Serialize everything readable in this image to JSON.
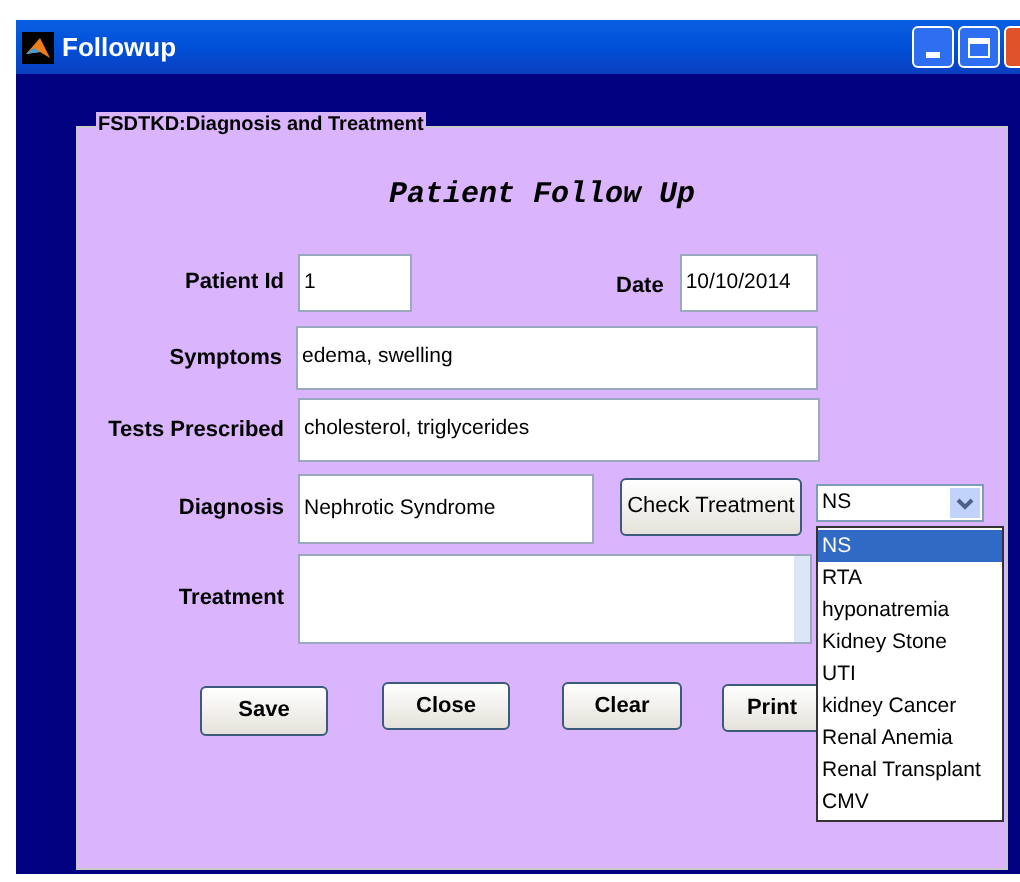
{
  "window": {
    "title": "Followup"
  },
  "panel": {
    "title": "FSDTKD:Diagnosis and Treatment"
  },
  "heading": "Patient Follow Up",
  "patient_id": {
    "label": "Patient Id",
    "value": "1"
  },
  "date": {
    "label": "Date",
    "value": "10/10/2014"
  },
  "symptoms": {
    "label": "Symptoms",
    "value": "edema, swelling"
  },
  "tests": {
    "label": "Tests Prescribed",
    "value": "cholesterol, triglycerides"
  },
  "diagnosis": {
    "label": "Diagnosis",
    "value": "Nephrotic Syndrome"
  },
  "check_button": "Check Treatment",
  "dropdown": {
    "value": "NS",
    "expanded": true,
    "options": [
      {
        "label": "NS",
        "selected": true
      },
      {
        "label": "RTA",
        "selected": false
      },
      {
        "label": "hyponatremia",
        "selected": false
      },
      {
        "label": "Kidney Stone",
        "selected": false
      },
      {
        "label": "UTI",
        "selected": false
      },
      {
        "label": "kidney Cancer",
        "selected": false
      },
      {
        "label": "Renal Anemia",
        "selected": false
      },
      {
        "label": "Renal Transplant",
        "selected": false
      },
      {
        "label": "CMV",
        "selected": false
      }
    ]
  },
  "treatment": {
    "label": "Treatment"
  },
  "buttons": [
    "Save",
    "Close",
    "Clear",
    "Print"
  ]
}
